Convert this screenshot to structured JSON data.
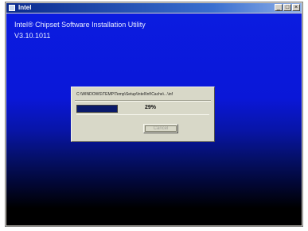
{
  "window": {
    "title": "Intel",
    "buttons": {
      "minimize": "_",
      "maximize": "□",
      "close": "×"
    }
  },
  "installer": {
    "heading": "Intel® Chipset Software Installation Utility",
    "version": "V3.10.1011"
  },
  "progress_dialog": {
    "path": "C:\\WINDOWS\\TEMP\\Temp\\Setup\\Intel\\Inf\\Cache\\...\\inf",
    "percent_label": "29%",
    "progress_fraction": 0.29,
    "button_label": "Cancel"
  },
  "colors": {
    "background_top": "#0b1ce0",
    "background_bottom": "#000000",
    "progress_fill": "#0a1a6a"
  }
}
